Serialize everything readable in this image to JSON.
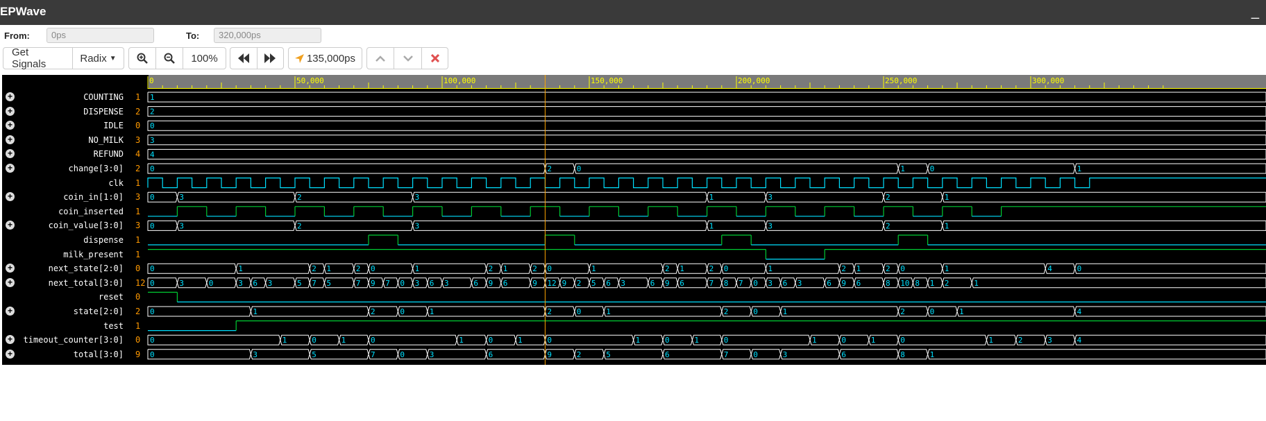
{
  "app": {
    "title": "EPWave",
    "minimize": "_"
  },
  "range": {
    "from_label": "From:",
    "from_value": "0ps",
    "to_label": "To:",
    "to_value": "320,000ps"
  },
  "toolbar": {
    "get_signals": "Get Signals",
    "radix": "Radix",
    "zoom_level": "100%",
    "cursor_time": "135,000ps"
  },
  "ruler": {
    "ticks": [
      "0",
      "50,000",
      "100,000",
      "150,000",
      "200,000",
      "250,000",
      "300,000"
    ],
    "range_ps": [
      0,
      320000
    ],
    "cursor_ps": 135000
  },
  "signals": [
    {
      "name": "COUNTING",
      "value": "1",
      "expandable": true,
      "kind": "bus",
      "seg": [
        [
          0,
          "1"
        ]
      ]
    },
    {
      "name": "DISPENSE",
      "value": "2",
      "expandable": true,
      "kind": "bus",
      "seg": [
        [
          0,
          "2"
        ]
      ]
    },
    {
      "name": "IDLE",
      "value": "0",
      "expandable": true,
      "kind": "bus",
      "seg": [
        [
          0,
          "0"
        ]
      ]
    },
    {
      "name": "NO_MILK",
      "value": "3",
      "expandable": true,
      "kind": "bus",
      "seg": [
        [
          0,
          "3"
        ]
      ]
    },
    {
      "name": "REFUND",
      "value": "4",
      "expandable": true,
      "kind": "bus",
      "seg": [
        [
          0,
          "4"
        ]
      ]
    },
    {
      "name": "change[3:0]",
      "value": "2",
      "expandable": true,
      "kind": "bus",
      "seg": [
        [
          0,
          "0"
        ],
        [
          135000,
          "2"
        ],
        [
          145000,
          "0"
        ],
        [
          255000,
          "1"
        ],
        [
          265000,
          "0"
        ],
        [
          315000,
          "1"
        ]
      ]
    },
    {
      "name": "clk",
      "value": "1",
      "expandable": false,
      "kind": "clock",
      "period": 10000,
      "color": "#00e0ff"
    },
    {
      "name": "coin_in[1:0]",
      "value": "3",
      "expandable": true,
      "kind": "bus",
      "seg": [
        [
          0,
          "0"
        ],
        [
          10000,
          "3"
        ],
        [
          50000,
          "2"
        ],
        [
          90000,
          "3"
        ],
        [
          190000,
          "1"
        ],
        [
          210000,
          "3"
        ],
        [
          250000,
          "2"
        ],
        [
          270000,
          "1"
        ]
      ]
    },
    {
      "name": "coin_inserted",
      "value": "1",
      "expandable": false,
      "kind": "bit",
      "edges": [
        [
          0,
          0
        ],
        [
          10000,
          1
        ],
        [
          20000,
          0
        ],
        [
          30000,
          1
        ],
        [
          40000,
          0
        ],
        [
          50000,
          1
        ],
        [
          60000,
          0
        ],
        [
          70000,
          1
        ],
        [
          80000,
          0
        ],
        [
          90000,
          1
        ],
        [
          100000,
          0
        ],
        [
          110000,
          1
        ],
        [
          120000,
          0
        ],
        [
          130000,
          1
        ],
        [
          140000,
          0
        ],
        [
          150000,
          1
        ],
        [
          160000,
          0
        ],
        [
          170000,
          1
        ],
        [
          180000,
          0
        ],
        [
          190000,
          1
        ],
        [
          200000,
          0
        ],
        [
          210000,
          1
        ],
        [
          220000,
          0
        ],
        [
          230000,
          1
        ],
        [
          240000,
          0
        ],
        [
          250000,
          1
        ],
        [
          260000,
          0
        ],
        [
          270000,
          1
        ],
        [
          280000,
          0
        ],
        [
          290000,
          1
        ]
      ]
    },
    {
      "name": "coin_value[3:0]",
      "value": "3",
      "expandable": true,
      "kind": "bus",
      "seg": [
        [
          0,
          "0"
        ],
        [
          10000,
          "3"
        ],
        [
          50000,
          "2"
        ],
        [
          90000,
          "3"
        ],
        [
          190000,
          "1"
        ],
        [
          210000,
          "3"
        ],
        [
          250000,
          "2"
        ],
        [
          270000,
          "1"
        ]
      ]
    },
    {
      "name": "dispense",
      "value": "1",
      "expandable": false,
      "kind": "bit",
      "edges": [
        [
          0,
          0
        ],
        [
          75000,
          1
        ],
        [
          85000,
          0
        ],
        [
          135000,
          1
        ],
        [
          145000,
          0
        ],
        [
          195000,
          1
        ],
        [
          205000,
          0
        ],
        [
          255000,
          1
        ],
        [
          265000,
          0
        ]
      ]
    },
    {
      "name": "milk_present",
      "value": "1",
      "expandable": false,
      "kind": "bit",
      "edges": [
        [
          0,
          1
        ],
        [
          210000,
          0
        ],
        [
          230000,
          1
        ]
      ]
    },
    {
      "name": "next_state[2:0]",
      "value": "0",
      "expandable": true,
      "kind": "bus",
      "seg": [
        [
          0,
          "0"
        ],
        [
          30000,
          "1"
        ],
        [
          55000,
          "2"
        ],
        [
          60000,
          "1"
        ],
        [
          70000,
          "2"
        ],
        [
          75000,
          "0"
        ],
        [
          90000,
          "1"
        ],
        [
          115000,
          "2"
        ],
        [
          120000,
          "1"
        ],
        [
          130000,
          "2"
        ],
        [
          135000,
          "0"
        ],
        [
          150000,
          "1"
        ],
        [
          175000,
          "2"
        ],
        [
          180000,
          "1"
        ],
        [
          190000,
          "2"
        ],
        [
          195000,
          "0"
        ],
        [
          210000,
          "1"
        ],
        [
          235000,
          "2"
        ],
        [
          240000,
          "1"
        ],
        [
          250000,
          "2"
        ],
        [
          255000,
          "0"
        ],
        [
          270000,
          "1"
        ],
        [
          305000,
          "4"
        ],
        [
          315000,
          "0"
        ]
      ]
    },
    {
      "name": "next_total[3:0]",
      "value": "12",
      "expandable": true,
      "kind": "bus",
      "seg": [
        [
          0,
          "0"
        ],
        [
          10000,
          "3"
        ],
        [
          20000,
          "0"
        ],
        [
          30000,
          "3"
        ],
        [
          35000,
          "6"
        ],
        [
          40000,
          "3"
        ],
        [
          50000,
          "5"
        ],
        [
          55000,
          "7"
        ],
        [
          60000,
          "5"
        ],
        [
          70000,
          "7"
        ],
        [
          75000,
          "9"
        ],
        [
          80000,
          "7"
        ],
        [
          85000,
          "0"
        ],
        [
          90000,
          "3"
        ],
        [
          95000,
          "6"
        ],
        [
          100000,
          "3"
        ],
        [
          110000,
          "6"
        ],
        [
          115000,
          "9"
        ],
        [
          120000,
          "6"
        ],
        [
          130000,
          "9"
        ],
        [
          135000,
          "12"
        ],
        [
          140000,
          "9"
        ],
        [
          145000,
          "2"
        ],
        [
          150000,
          "5"
        ],
        [
          155000,
          "6"
        ],
        [
          160000,
          "3"
        ],
        [
          170000,
          "6"
        ],
        [
          175000,
          "9"
        ],
        [
          180000,
          "6"
        ],
        [
          190000,
          "7"
        ],
        [
          195000,
          "8"
        ],
        [
          200000,
          "7"
        ],
        [
          205000,
          "0"
        ],
        [
          210000,
          "3"
        ],
        [
          215000,
          "6"
        ],
        [
          220000,
          "3"
        ],
        [
          230000,
          "6"
        ],
        [
          235000,
          "9"
        ],
        [
          240000,
          "6"
        ],
        [
          250000,
          "8"
        ],
        [
          255000,
          "10"
        ],
        [
          260000,
          "8"
        ],
        [
          265000,
          "1"
        ],
        [
          270000,
          "2"
        ],
        [
          280000,
          "1"
        ]
      ]
    },
    {
      "name": "reset",
      "value": "0",
      "expandable": false,
      "kind": "bit",
      "edges": [
        [
          0,
          1
        ],
        [
          10000,
          0
        ]
      ]
    },
    {
      "name": "state[2:0]",
      "value": "2",
      "expandable": true,
      "kind": "bus",
      "seg": [
        [
          0,
          "0"
        ],
        [
          35000,
          "1"
        ],
        [
          75000,
          "2"
        ],
        [
          85000,
          "0"
        ],
        [
          95000,
          "1"
        ],
        [
          135000,
          "2"
        ],
        [
          145000,
          "0"
        ],
        [
          155000,
          "1"
        ],
        [
          195000,
          "2"
        ],
        [
          205000,
          "0"
        ],
        [
          215000,
          "1"
        ],
        [
          255000,
          "2"
        ],
        [
          265000,
          "0"
        ],
        [
          275000,
          "1"
        ],
        [
          315000,
          "4"
        ]
      ]
    },
    {
      "name": "test",
      "value": "1",
      "expandable": false,
      "kind": "bit",
      "edges": [
        [
          0,
          0
        ],
        [
          30000,
          1
        ]
      ]
    },
    {
      "name": "timeout_counter[3:0]",
      "value": "0",
      "expandable": true,
      "kind": "bus",
      "seg": [
        [
          0,
          "0"
        ],
        [
          45000,
          "1"
        ],
        [
          55000,
          "0"
        ],
        [
          65000,
          "1"
        ],
        [
          75000,
          "0"
        ],
        [
          105000,
          "1"
        ],
        [
          115000,
          "0"
        ],
        [
          125000,
          "1"
        ],
        [
          135000,
          "0"
        ],
        [
          165000,
          "1"
        ],
        [
          175000,
          "0"
        ],
        [
          185000,
          "1"
        ],
        [
          195000,
          "0"
        ],
        [
          225000,
          "1"
        ],
        [
          235000,
          "0"
        ],
        [
          245000,
          "1"
        ],
        [
          255000,
          "0"
        ],
        [
          285000,
          "1"
        ],
        [
          295000,
          "2"
        ],
        [
          305000,
          "3"
        ],
        [
          315000,
          "4"
        ]
      ]
    },
    {
      "name": "total[3:0]",
      "value": "9",
      "expandable": true,
      "kind": "bus",
      "seg": [
        [
          0,
          "0"
        ],
        [
          35000,
          "3"
        ],
        [
          55000,
          "5"
        ],
        [
          75000,
          "7"
        ],
        [
          85000,
          "0"
        ],
        [
          95000,
          "3"
        ],
        [
          115000,
          "6"
        ],
        [
          135000,
          "9"
        ],
        [
          145000,
          "2"
        ],
        [
          155000,
          "5"
        ],
        [
          175000,
          "6"
        ],
        [
          195000,
          "7"
        ],
        [
          205000,
          "0"
        ],
        [
          215000,
          "3"
        ],
        [
          235000,
          "6"
        ],
        [
          255000,
          "8"
        ],
        [
          265000,
          "1"
        ]
      ]
    }
  ],
  "colors": {
    "bus_line": "#ffffff",
    "bus_text": "#00e0ff",
    "bit_high": "#00cc33",
    "bit_low": "#00e0ff",
    "ruler_tick": "#ffff00",
    "cursor": "#ffa500",
    "value_text": "#ff9900"
  }
}
